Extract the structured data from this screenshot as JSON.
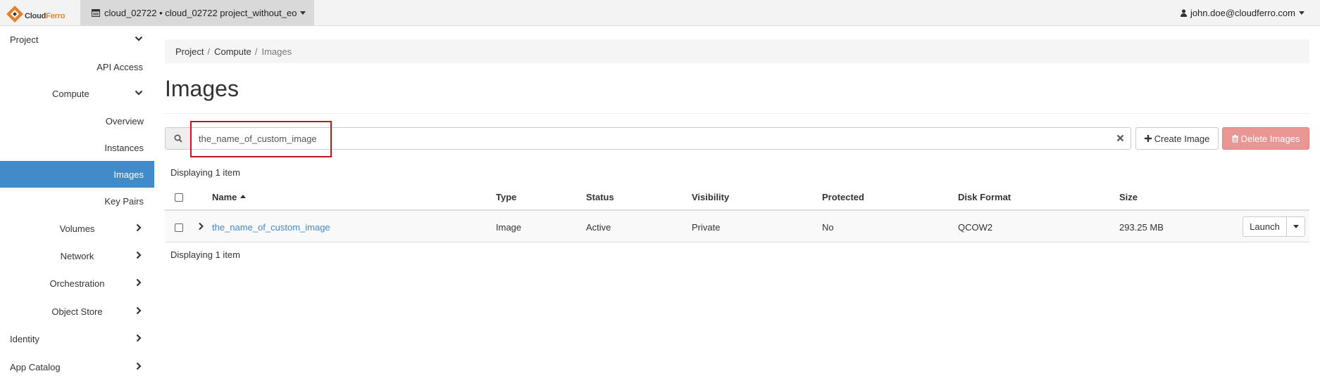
{
  "brand": {
    "part1": "Cloud",
    "part2": "Ferro"
  },
  "topbar": {
    "project_selector": "cloud_02722 • cloud_02722 project_without_eo",
    "user": "john.doe@cloudferro.com"
  },
  "sidebar": {
    "items": [
      {
        "label": "Project"
      },
      {
        "label": "API Access"
      },
      {
        "label": "Compute"
      },
      {
        "label": "Overview"
      },
      {
        "label": "Instances"
      },
      {
        "label": "Images"
      },
      {
        "label": "Key Pairs"
      },
      {
        "label": "Volumes"
      },
      {
        "label": "Network"
      },
      {
        "label": "Orchestration"
      },
      {
        "label": "Object Store"
      },
      {
        "label": "Identity"
      },
      {
        "label": "App Catalog"
      }
    ]
  },
  "breadcrumb": [
    "Project",
    "Compute",
    "Images"
  ],
  "page": {
    "title": "Images"
  },
  "search": {
    "value": "the_name_of_custom_image"
  },
  "actions": {
    "create": "Create Image",
    "delete": "Delete Images"
  },
  "table": {
    "displaying_top": "Displaying 1 item",
    "displaying_bottom": "Displaying 1 item",
    "columns": [
      "Name",
      "Type",
      "Status",
      "Visibility",
      "Protected",
      "Disk Format",
      "Size"
    ],
    "rows": [
      {
        "name": "the_name_of_custom_image",
        "type": "Image",
        "status": "Active",
        "visibility": "Private",
        "protected": "No",
        "disk_format": "QCOW2",
        "size": "293.25 MB",
        "action": "Launch"
      }
    ]
  },
  "colors": {
    "accent": "#428bca",
    "danger": "#e99694",
    "highlight": "#c4161c",
    "brand": "#e8802b"
  }
}
